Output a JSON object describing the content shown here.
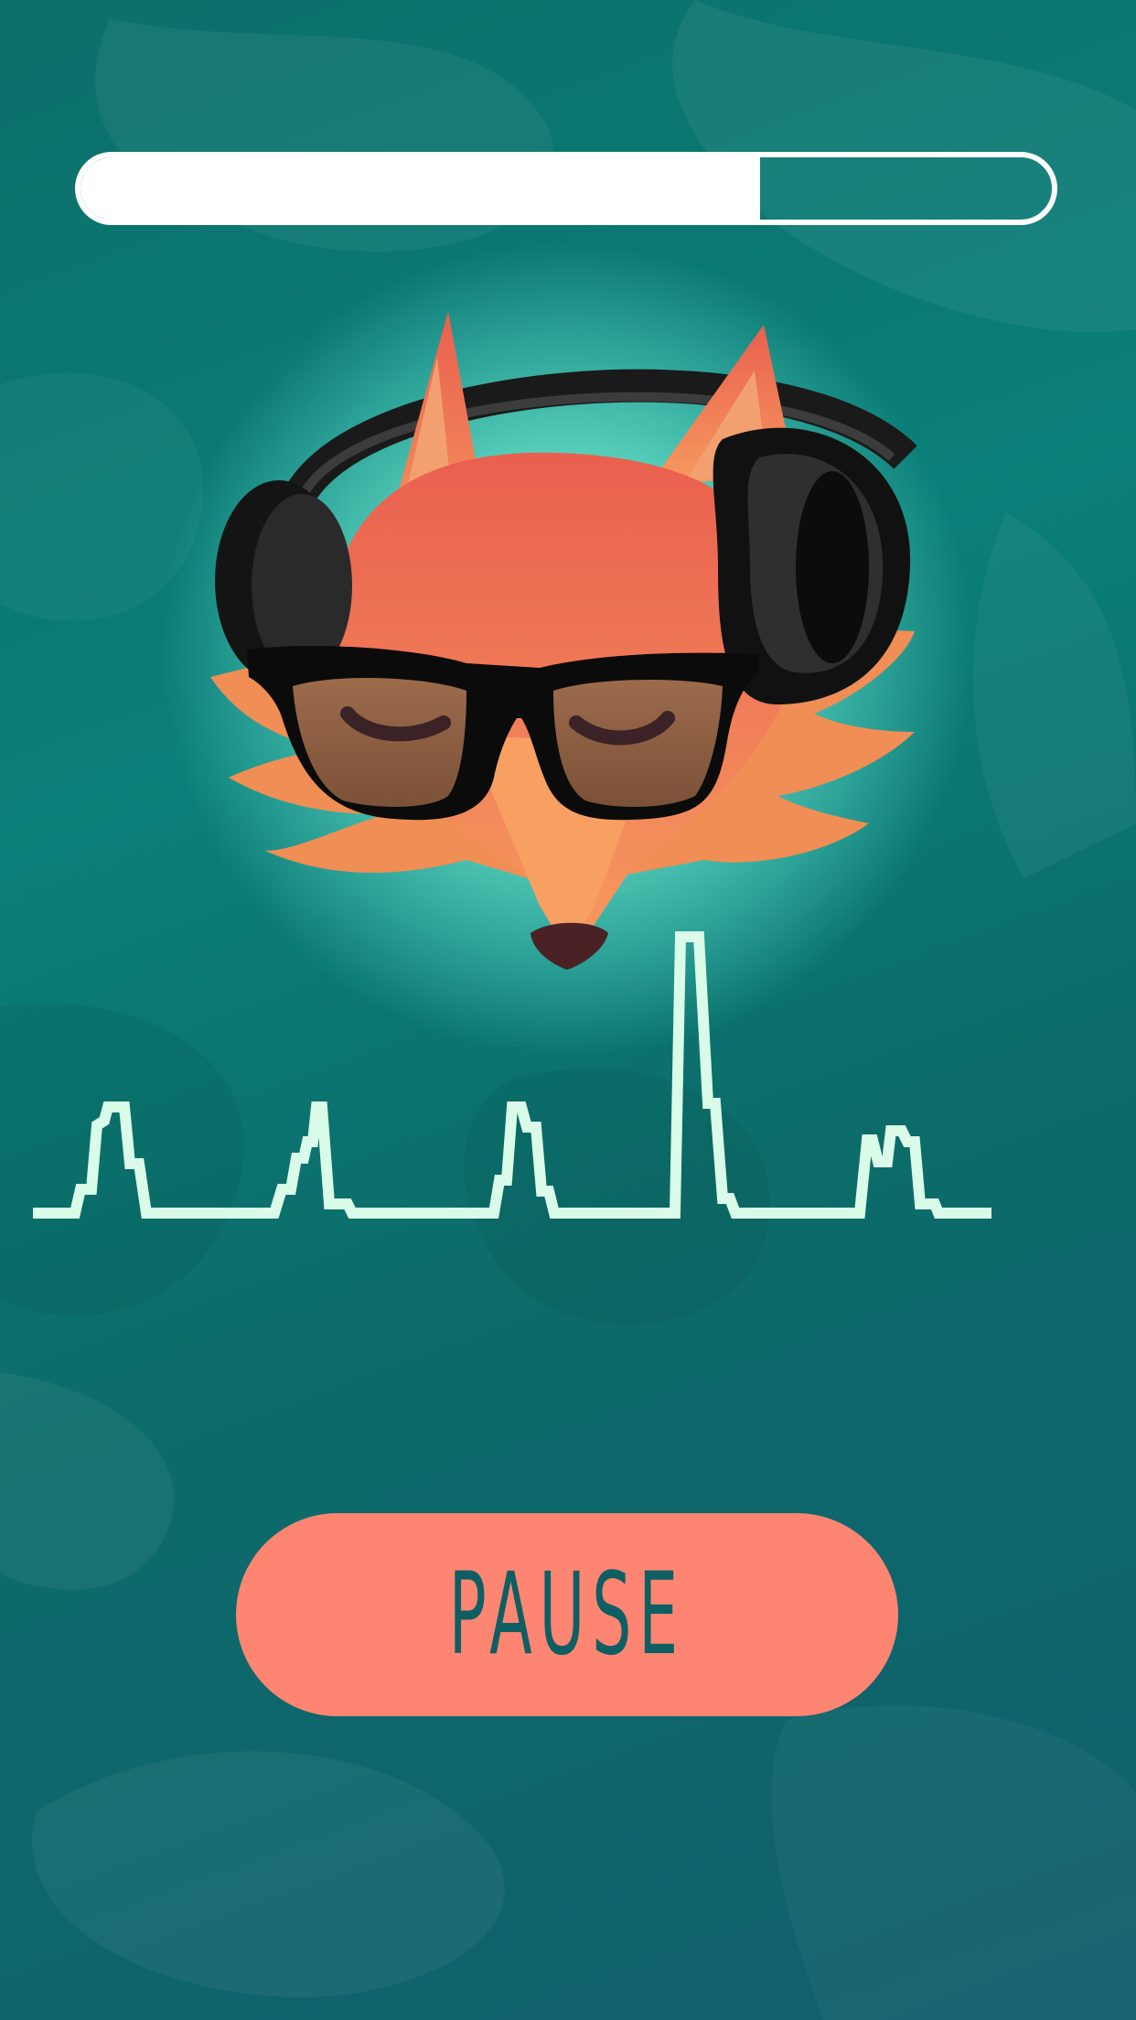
{
  "player": {
    "progress_fraction": 0.7,
    "pause_label": "PAUSE"
  },
  "icons": {
    "mascot": "fox-with-headphones-and-sunglasses-icon",
    "waveform": "audio-waveform-icon"
  },
  "colors": {
    "background_top": "#0c6f6a",
    "background_bottom": "#115e6e",
    "progress": "#ffffff",
    "waveform": "#d9fbe8",
    "button": "#ff8573",
    "button_text": "#0e5f63",
    "glow": "#7ee8cf"
  }
}
